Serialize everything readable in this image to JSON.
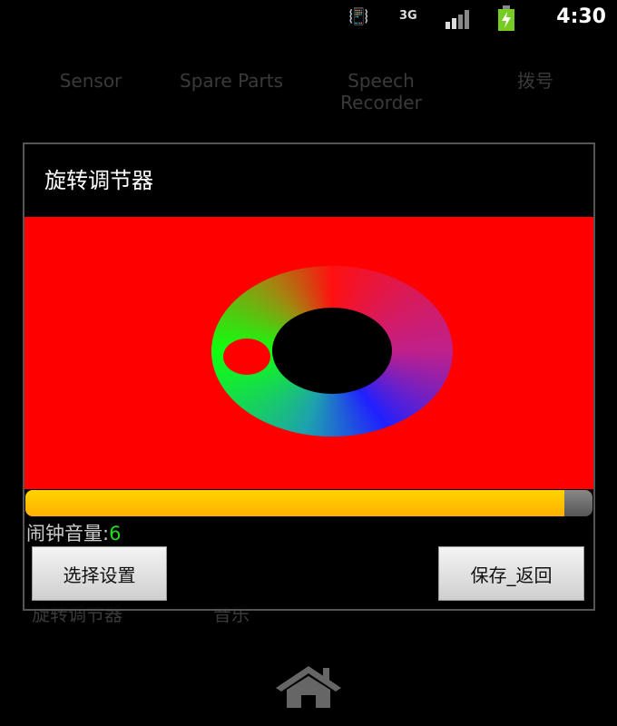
{
  "status_bar": {
    "time": "4:30",
    "icons": [
      "vibrate-icon",
      "3g-icon",
      "signal-icon",
      "battery-charging-icon"
    ]
  },
  "background_apps": [
    "Sensor",
    "Spare Parts",
    "Speech Recorder",
    "拨号",
    "旋转调节器",
    "音乐"
  ],
  "dialog": {
    "title": "旋转调节器",
    "colors": {
      "canvas": "#ff0000",
      "knob": "#ff0000",
      "bar": "#ffc000"
    },
    "volume_progress_percent": 95,
    "volume_label": "闹钟音量:",
    "volume_value": "6",
    "select_button": "选择设置",
    "save_button": "保存_返回"
  },
  "nav": {
    "home_icon": "home-icon"
  }
}
